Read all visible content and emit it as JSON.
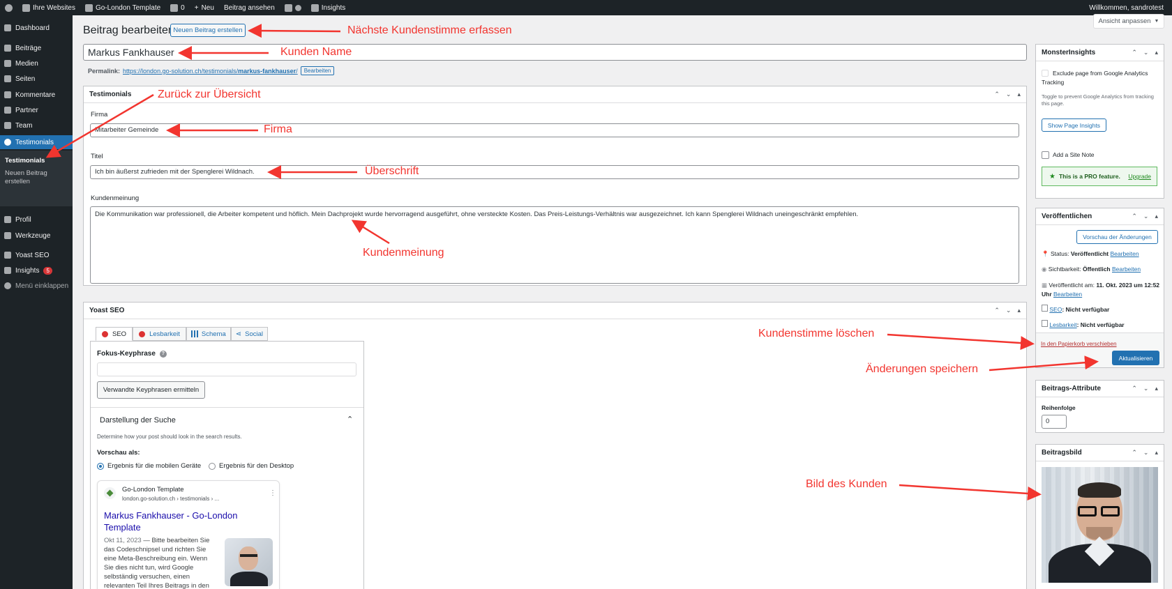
{
  "adminbar": {
    "sites": "Ihre Websites",
    "site_name": "Go-London Template",
    "comments": "0",
    "new": "Neu",
    "view_post": "Beitrag ansehen",
    "insights": "Insights",
    "welcome": "Willkommen, sandrotest"
  },
  "sidebar": {
    "items": [
      {
        "label": "Dashboard",
        "icon": "dashboard-icon"
      },
      {
        "label": "Beiträge",
        "icon": "pin-icon"
      },
      {
        "label": "Medien",
        "icon": "media-icon"
      },
      {
        "label": "Seiten",
        "icon": "page-icon"
      },
      {
        "label": "Kommentare",
        "icon": "comment-icon"
      },
      {
        "label": "Partner",
        "icon": "user-icon"
      },
      {
        "label": "Team",
        "icon": "team-icon"
      },
      {
        "label": "Testimonials",
        "icon": "heart-icon"
      },
      {
        "label": "Profil",
        "icon": "user-icon"
      },
      {
        "label": "Werkzeuge",
        "icon": "wrench-icon"
      },
      {
        "label": "Yoast SEO",
        "icon": "yoast-icon"
      },
      {
        "label": "Insights",
        "icon": "insights-icon"
      },
      {
        "label": "Menü einklappen",
        "icon": "collapse-icon"
      }
    ],
    "insights_badge": "5",
    "submenu": {
      "current": "Testimonials",
      "new": "Neuen Beitrag erstellen"
    }
  },
  "header": {
    "title": "Beitrag bearbeiten",
    "new_button": "Neuen Beitrag erstellen",
    "screen_options": "Ansicht anpassen"
  },
  "post": {
    "title": "Markus Fankhauser",
    "permalink_label": "Permalink:",
    "permalink_base": "https://london.go-solution.ch/testimonials/",
    "permalink_slug": "markus-fankhauser",
    "permalink_slash": "/",
    "edit_button": "Bearbeiten"
  },
  "testimonials_box": {
    "title": "Testimonials",
    "firma_label": "Firma",
    "firma_value": "Mitarbeiter Gemeinde",
    "titel_label": "Titel",
    "titel_value": "Ich bin äußerst zufrieden mit der Spenglerei Wildnach.",
    "meinung_label": "Kundenmeinung",
    "meinung_value": "Die Kommunikation war professionell, die Arbeiter kompetent und höflich. Mein Dachprojekt wurde hervorragend ausgeführt, ohne versteckte Kosten. Das Preis-Leistungs-Verhältnis war ausgezeichnet. Ich kann Spenglerei Wildnach uneingeschränkt empfehlen."
  },
  "yoast": {
    "title": "Yoast SEO",
    "tabs": [
      "SEO",
      "Lesbarkeit",
      "Schema",
      "Social"
    ],
    "keyphrase_label": "Fokus-Keyphrase",
    "keyphrase_value": "",
    "related_button": "Verwandte Keyphrasen ermitteln",
    "search_title": "Darstellung der Suche",
    "search_desc": "Determine how your post should look in the search results.",
    "preview_label": "Vorschau als:",
    "radio_mobile": "Ergebnis für die mobilen Geräte",
    "radio_desktop": "Ergebnis für den Desktop",
    "snippet": {
      "site": "Go-London Template",
      "url": "london.go-solution.ch › testimonials › ...",
      "title": "Markus Fankhauser - Go-London Template",
      "date": "Okt 11, 2023",
      "desc": "Bitte bearbeiten Sie das Codeschnipsel und richten Sie eine Meta-Beschreibung ein. Wenn Sie dies nicht tun, wird Google selbständig versuchen, einen relevanten Teil Ihres Beitrags in den Suchergebnissen"
    }
  },
  "monster": {
    "title": "MonsterInsights",
    "exclude_label": "Exclude page from Google Analytics Tracking",
    "toggle_help": "Toggle to prevent Google Analytics from tracking this page.",
    "show_button": "Show Page Insights",
    "site_note": "Add a Site Note",
    "pro_text": "This is a PRO feature.",
    "upgrade": "Upgrade"
  },
  "publish": {
    "title": "Veröffentlichen",
    "preview_button": "Vorschau der Änderungen",
    "status_label": "Status:",
    "status_value": "Veröffentlicht",
    "visibility_label": "Sichtbarkeit:",
    "visibility_value": "Öffentlich",
    "published_label": "Veröffentlicht am:",
    "published_value": "11. Okt. 2023 um 12:52 Uhr",
    "edit": "Bearbeiten",
    "seo_label": "SEO",
    "seo_value": ": Nicht verfügbar",
    "read_label": "Lesbarkeit",
    "read_value": ": Nicht verfügbar",
    "trash": "In den Papierkorb verschieben",
    "update_button": "Aktualisieren"
  },
  "attributes": {
    "title": "Beitrags-Attribute",
    "order_label": "Reihenfolge",
    "order_value": "0"
  },
  "featured": {
    "title": "Beitragsbild"
  },
  "annotations": {
    "next": "Nächste Kundenstimme erfassen",
    "name": "Kunden Name",
    "back": "Zurück zur Übersicht",
    "firma": "Firma",
    "heading": "Überschrift",
    "opinion": "Kundenmeinung",
    "delete": "Kundenstimme löschen",
    "save": "Änderungen speichern",
    "image": "Bild des Kunden"
  },
  "colors": {
    "accent": "#2271b1",
    "annotation": "#f2352f",
    "adminbar": "#1d2327"
  }
}
